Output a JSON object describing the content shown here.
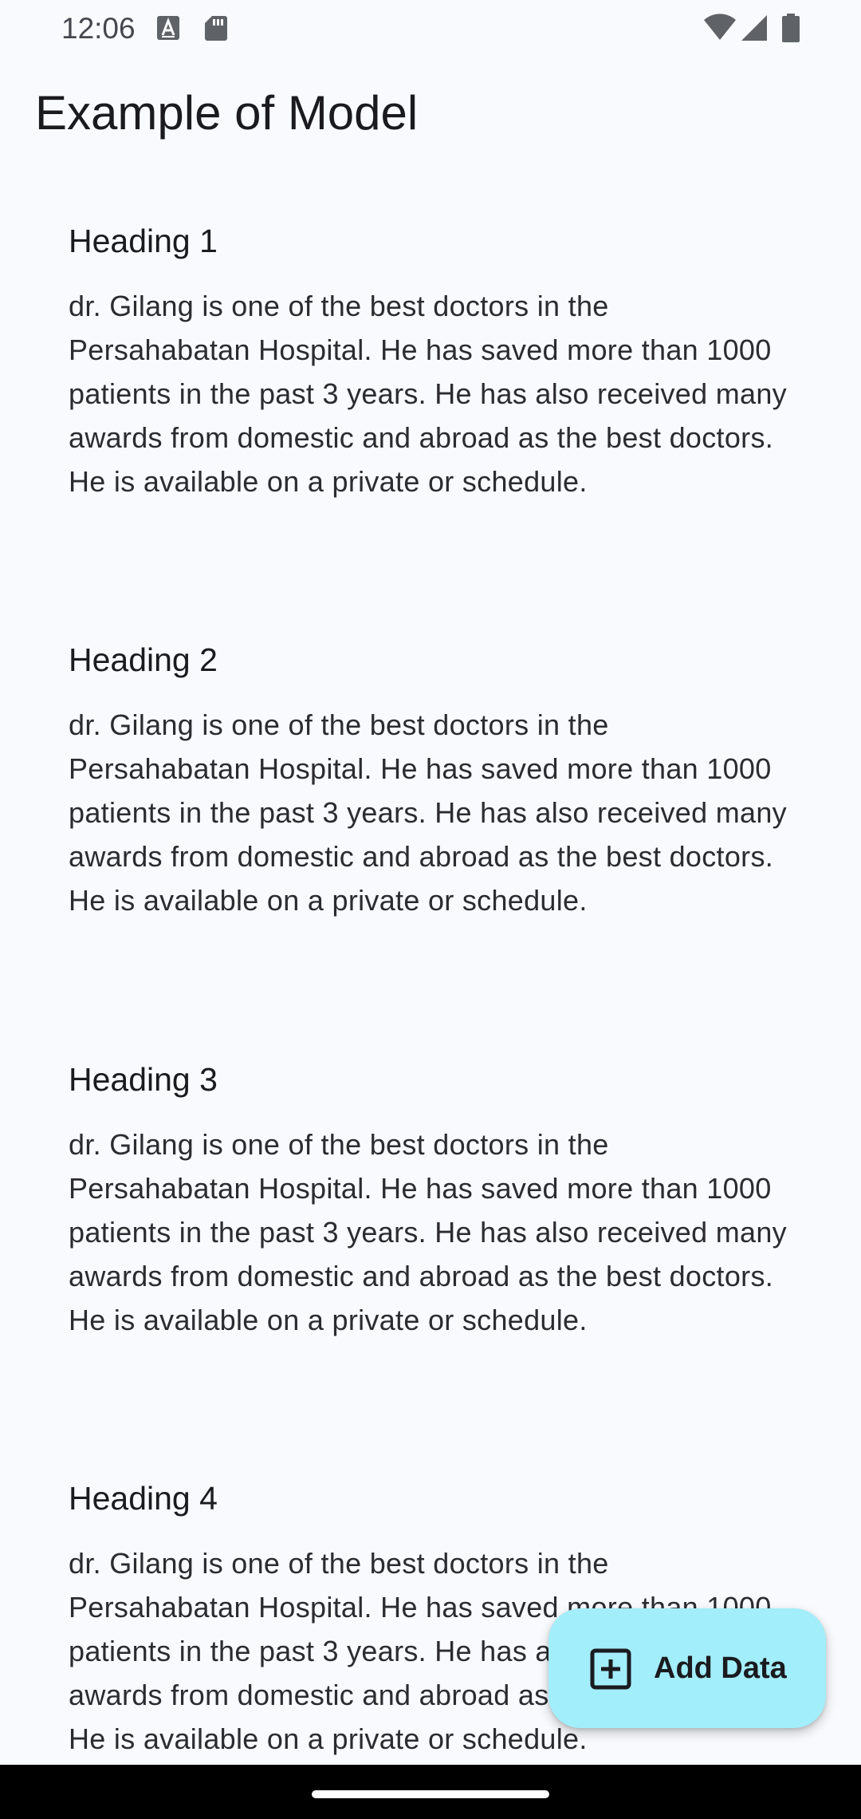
{
  "status_bar": {
    "time": "12:06",
    "left_icons": [
      "font-download-icon",
      "sd-card-icon"
    ],
    "right_icons": [
      "wifi-icon",
      "cellular-signal-icon",
      "battery-icon"
    ]
  },
  "app_bar": {
    "title": "Example of Model"
  },
  "items": [
    {
      "heading": "Heading 1",
      "body": "dr. Gilang is one of the best doctors in the Persahabatan Hospital. He has saved more than 1000 patients in the past 3 years. He has also received many awards from domestic and abroad as the best doctors. He is available on a private or schedule."
    },
    {
      "heading": "Heading 2",
      "body": "dr. Gilang is one of the best doctors in the Persahabatan Hospital. He has saved more than 1000 patients in the past 3 years. He has also received many awards from domestic and abroad as the best doctors. He is available on a private or schedule."
    },
    {
      "heading": "Heading 3",
      "body": "dr. Gilang is one of the best doctors in the Persahabatan Hospital. He has saved more than 1000 patients in the past 3 years. He has also received many awards from domestic and abroad as the best doctors. He is available on a private or schedule."
    },
    {
      "heading": "Heading 4",
      "body": "dr. Gilang is one of the best doctors in the Persahabatan Hospital. He has saved more than 1000 patients in the past 3 years. He has also received many awards from domestic and abroad as the best doctors. He is available on a private or schedule."
    }
  ],
  "fab": {
    "label": "Add Data",
    "icon": "add-box-icon",
    "color": "#a2eefa"
  },
  "colors": {
    "background": "#f8fafd",
    "nav_bar": "#000000"
  }
}
